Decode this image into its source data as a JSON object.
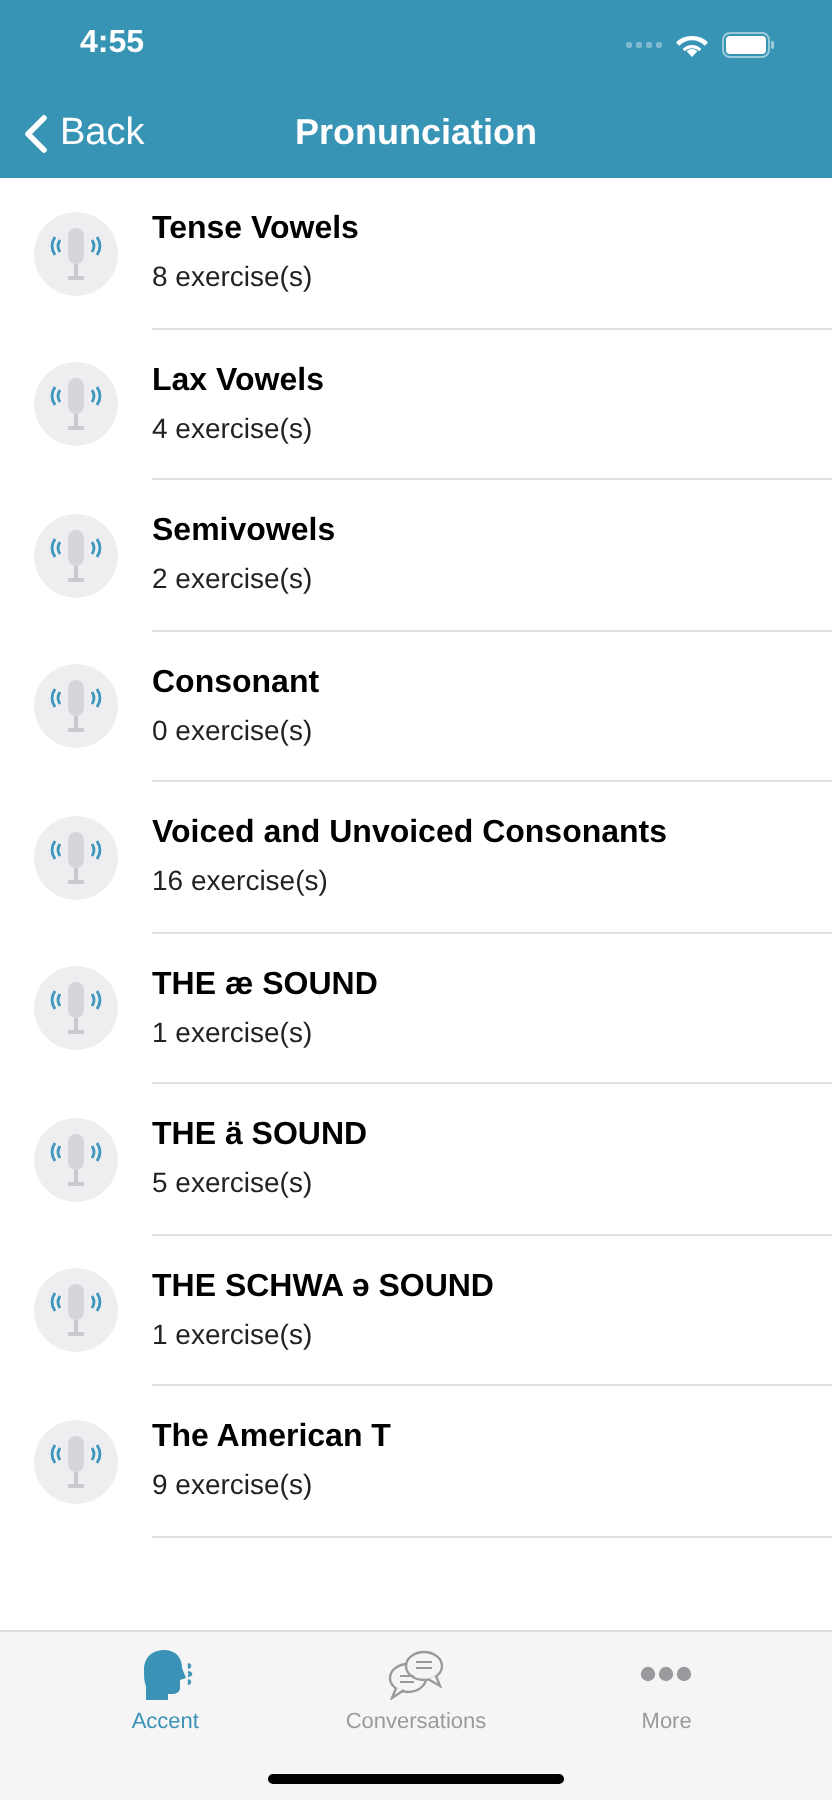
{
  "status_bar": {
    "time": "4:55"
  },
  "nav": {
    "back": "Back",
    "title": "Pronunciation"
  },
  "items": [
    {
      "title": "Tense Vowels",
      "subtitle": "8 exercise(s)"
    },
    {
      "title": "Lax Vowels",
      "subtitle": "4 exercise(s)"
    },
    {
      "title": "Semivowels",
      "subtitle": "2 exercise(s)"
    },
    {
      "title": "Consonant",
      "subtitle": "0 exercise(s)"
    },
    {
      "title": "Voiced and Unvoiced Consonants",
      "subtitle": "16 exercise(s)"
    },
    {
      "title": "THE æ SOUND",
      "subtitle": "1 exercise(s)"
    },
    {
      "title": "THE ä SOUND",
      "subtitle": "5 exercise(s)"
    },
    {
      "title": "THE SCHWA ə SOUND",
      "subtitle": "1 exercise(s)"
    },
    {
      "title": "The American T",
      "subtitle": "9 exercise(s)"
    }
  ],
  "tabs": [
    {
      "label": "Accent",
      "kind": "speaker",
      "selected": true
    },
    {
      "label": "Conversations",
      "kind": "chat",
      "selected": false
    },
    {
      "label": "More",
      "kind": "dots",
      "selected": false
    }
  ]
}
